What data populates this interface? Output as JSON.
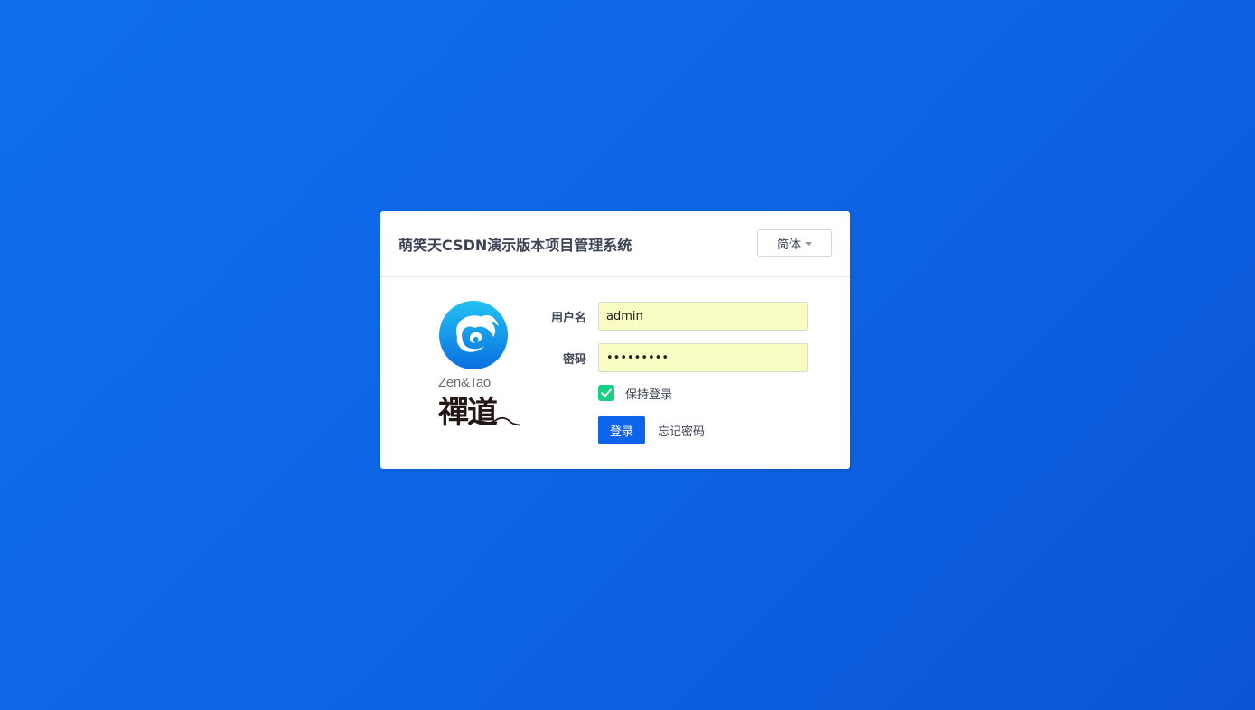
{
  "header": {
    "title": "萌笑天CSDN演示版本项目管理系统",
    "language_label": "简体"
  },
  "logo": {
    "english_text": "Zen&Tao",
    "chinese_text": "禪道"
  },
  "form": {
    "username_label": "用户名",
    "username_value": "admin",
    "password_label": "密码",
    "password_value": "123456789",
    "remember_label": "保持登录",
    "remember_checked": true,
    "login_button_label": "登录",
    "forgot_password_label": "忘记密码"
  },
  "colors": {
    "background": "#0f6fec",
    "primary_button": "#0c64eb",
    "checkbox": "#17ce82",
    "autofill_input": "#fafdc3"
  },
  "icons": {
    "language_dropdown": "caret-down-icon",
    "checkbox": "checkmark-icon"
  }
}
